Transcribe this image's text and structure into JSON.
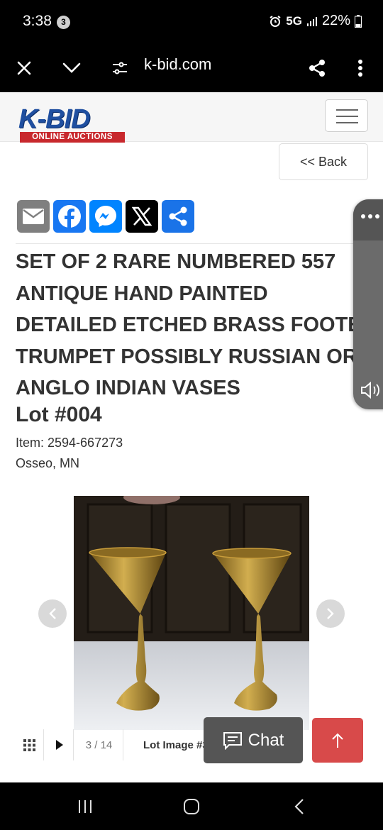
{
  "status": {
    "time": "3:38",
    "notification_count": "3",
    "network": "5G",
    "battery": "22%"
  },
  "browser": {
    "url": "k-bid.com"
  },
  "site": {
    "logo_text": "K-BID",
    "logo_sub": "ONLINE AUCTIONS",
    "back_label": "<< Back"
  },
  "share": {
    "items": [
      {
        "name": "email",
        "color": "#7f7f7f"
      },
      {
        "name": "facebook",
        "color": "#1877f2"
      },
      {
        "name": "messenger",
        "color": "#0084ff"
      },
      {
        "name": "x",
        "color": "#000000"
      },
      {
        "name": "share",
        "color": "#1a73e8"
      }
    ]
  },
  "lot": {
    "title_lines": [
      "SET OF 2 RARE NUMBERED 557",
      "ANTIQUE HAND PAINTED",
      "DETAILED ETCHED BRASS FOOTED",
      "TRUMPET POSSIBLY RUSSIAN OR",
      "ANGLO INDIAN VASES"
    ],
    "number": "Lot #004",
    "item": "Item: 2594-667273",
    "location": "Osseo, MN"
  },
  "gallery": {
    "counter": "3 / 14",
    "label": "Lot Image #3"
  },
  "chat": {
    "label": "Chat"
  }
}
